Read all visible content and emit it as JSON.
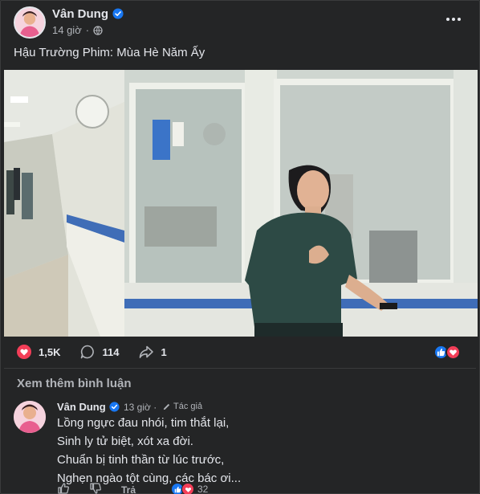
{
  "post": {
    "author": "Vân Dung",
    "time": "14 giờ",
    "separator": "·",
    "caption": "Hậu Trường Phim: Mùa Hè Năm Ấy",
    "icons": {
      "verified": "verified-badge-icon",
      "privacy": "globe-icon",
      "more": "more-horizontal-icon"
    }
  },
  "stats": {
    "reactions": "1,5K",
    "comments": "114",
    "shares": "1",
    "reaction_types": [
      "like",
      "love"
    ]
  },
  "comments_section": {
    "view_more": "Xem thêm bình luận",
    "items": [
      {
        "author": "Vân Dung",
        "time": "13 giờ",
        "separator": "·",
        "author_tag": "Tác giả",
        "lines": [
          "Lồng ngực đau nhói, tim thắt lại,",
          "Sinh ly tử biệt, xót xa đời.",
          "Chuẩn bị tinh thần từ lúc trước,",
          "Nghẹn ngào tột cùng, các bác ơi..."
        ],
        "reply_label": "Trả lời",
        "reaction_count": "32"
      }
    ]
  },
  "colors": {
    "background": "#242526",
    "text": "#e4e6eb",
    "secondary_text": "#b0b3b8",
    "like_blue": "#1877f2",
    "love_red": "#f33e58"
  }
}
